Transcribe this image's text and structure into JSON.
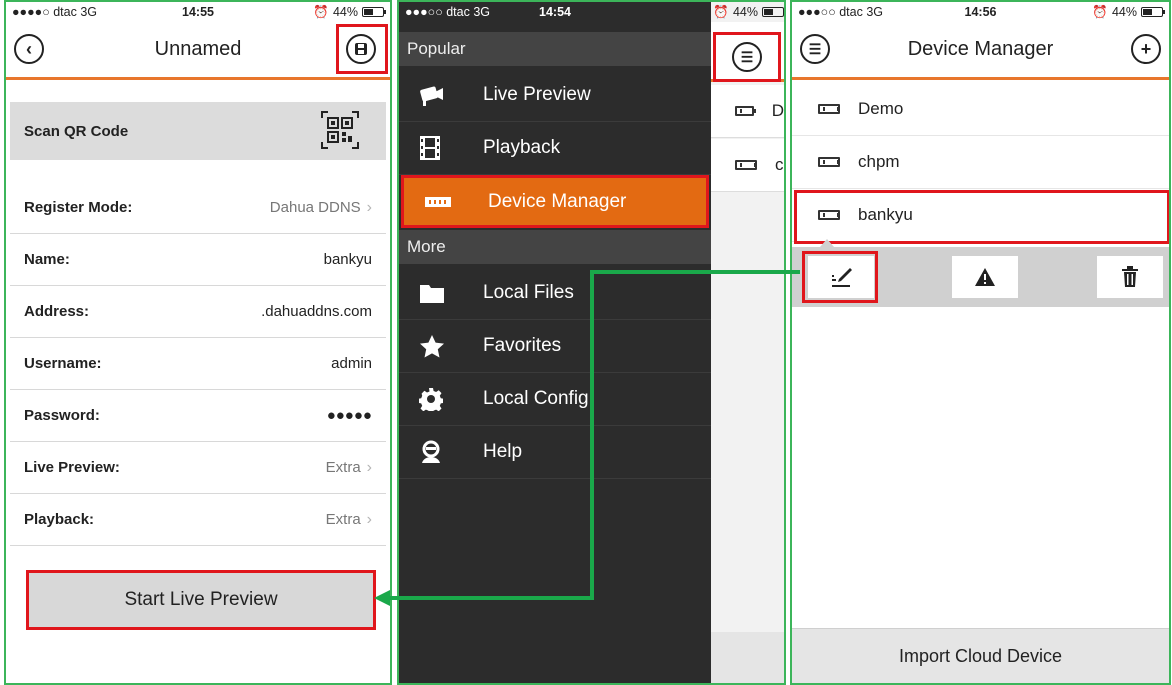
{
  "colors": {
    "accent": "#e8762c",
    "highlight": "#e0161c",
    "connector": "#1aa84a",
    "menu_bg": "#2c2c2c"
  },
  "screen1": {
    "status": {
      "carrier": "●●●●○ dtac  3G",
      "time": "14:55",
      "battery": "44%",
      "battery_level": 0.44
    },
    "title": "Unnamed",
    "back_icon": "back-circle-icon",
    "save_icon": "save-floppy-icon",
    "qr": {
      "label": "Scan QR Code",
      "icon": "qr-code-icon"
    },
    "rows": [
      {
        "label": "Register Mode:",
        "value": "Dahua DDNS",
        "chevron": true
      },
      {
        "label": "Name:",
        "value": "bankyu",
        "chevron": false
      },
      {
        "label": "Address:",
        "value": ".dahuaddns.com",
        "chevron": false
      },
      {
        "label": "Username:",
        "value": "admin",
        "chevron": false
      },
      {
        "label": "Password:",
        "value": "●●●●●",
        "chevron": false
      },
      {
        "label": "Live Preview:",
        "value": "Extra",
        "chevron": true
      },
      {
        "label": "Playback:",
        "value": "Extra",
        "chevron": true
      }
    ],
    "start_button": "Start Live Preview"
  },
  "screen2": {
    "status": {
      "carrier": "●●●○○ dtac  3G",
      "time": "14:54",
      "battery": "44%",
      "battery_level": 0.44
    },
    "menu_icon": "hamburger-menu-icon",
    "section_popular": "Popular",
    "section_more": "More",
    "popular_items": [
      {
        "label": "Live Preview",
        "icon": "camera-icon"
      },
      {
        "label": "Playback",
        "icon": "film-icon"
      },
      {
        "label": "Device Manager",
        "icon": "device-icon",
        "active": true
      }
    ],
    "more_items": [
      {
        "label": "Local Files",
        "icon": "folder-icon"
      },
      {
        "label": "Favorites",
        "icon": "star-icon"
      },
      {
        "label": "Local Config",
        "icon": "gear-icon"
      },
      {
        "label": "Help",
        "icon": "person-icon"
      }
    ],
    "peek_rows": [
      {
        "text": "D"
      },
      {
        "text": "c"
      }
    ]
  },
  "screen3": {
    "status": {
      "carrier": "●●●○○ dtac  3G",
      "time": "14:56",
      "battery": "44%",
      "battery_level": 0.44
    },
    "title": "Device Manager",
    "menu_icon": "hamburger-menu-icon",
    "add_icon": "add-circle-icon",
    "devices": [
      {
        "name": "Demo"
      },
      {
        "name": "chpm"
      },
      {
        "name": "bankyu"
      }
    ],
    "actions": [
      {
        "icon": "edit-icon",
        "glyph": "✎"
      },
      {
        "icon": "warning-icon",
        "glyph": "▲"
      },
      {
        "icon": "trash-icon",
        "glyph": "🗑"
      }
    ],
    "import_button": "Import Cloud Device"
  }
}
